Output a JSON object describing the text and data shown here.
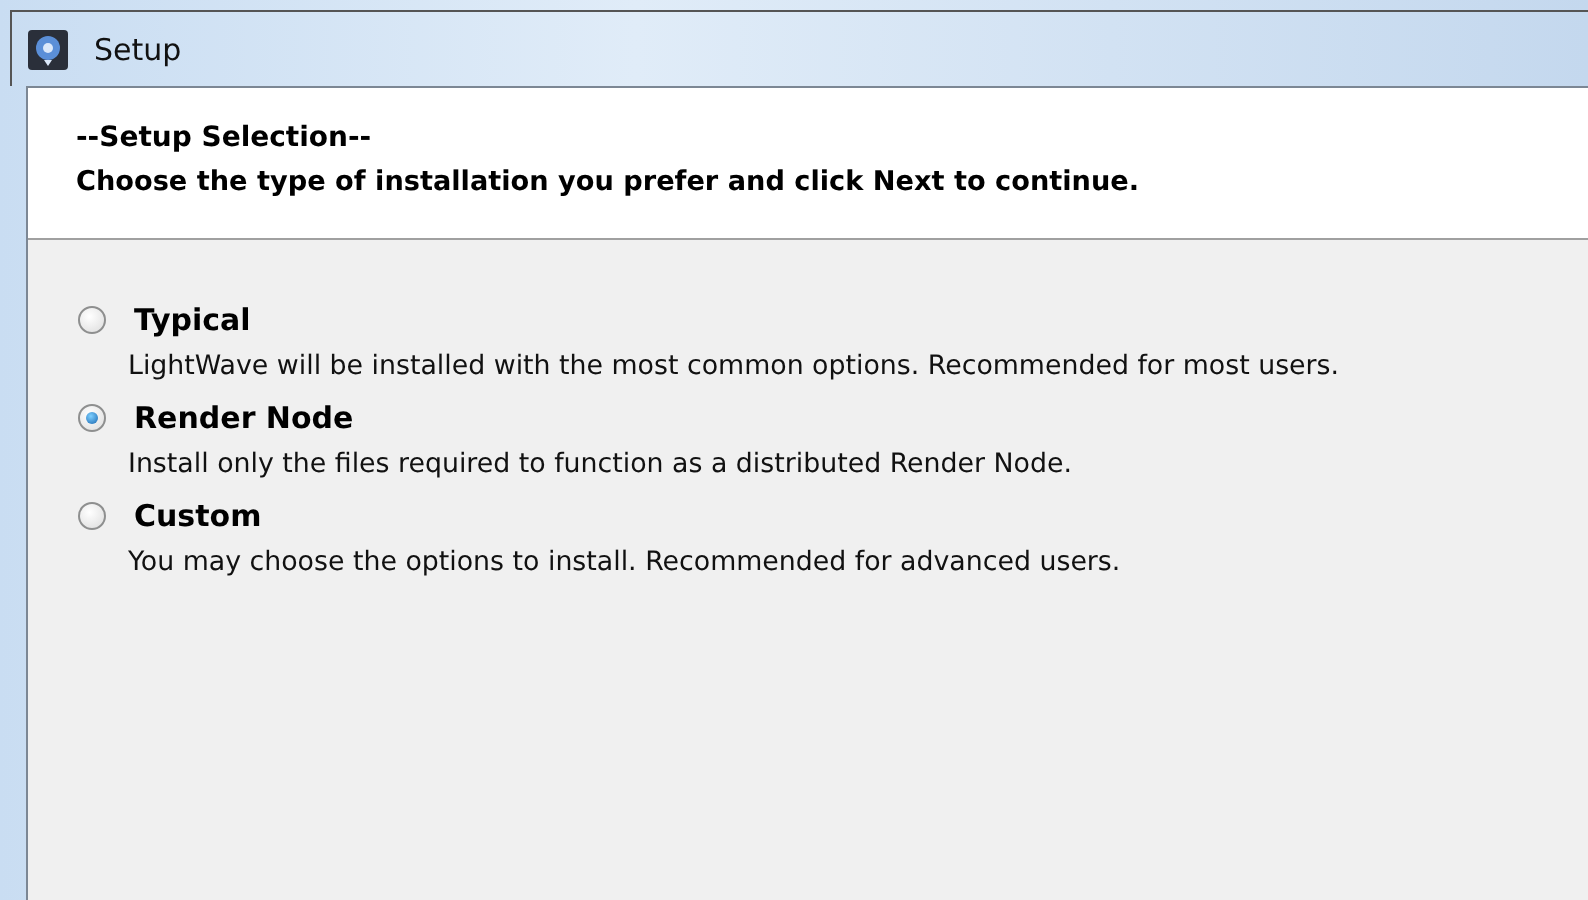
{
  "window": {
    "title": "Setup"
  },
  "header": {
    "title": "--Setup Selection--",
    "subtitle": "Choose the type of installation you prefer and click Next to continue."
  },
  "options": [
    {
      "label": "Typical",
      "description": "LightWave will be installed with the most common options. Recommended for most users.",
      "selected": false
    },
    {
      "label": "Render Node",
      "description": "Install only the files required to function as a distributed Render Node.",
      "selected": true
    },
    {
      "label": "Custom",
      "description": "You may choose the options to install. Recommended for advanced users.",
      "selected": false
    }
  ]
}
